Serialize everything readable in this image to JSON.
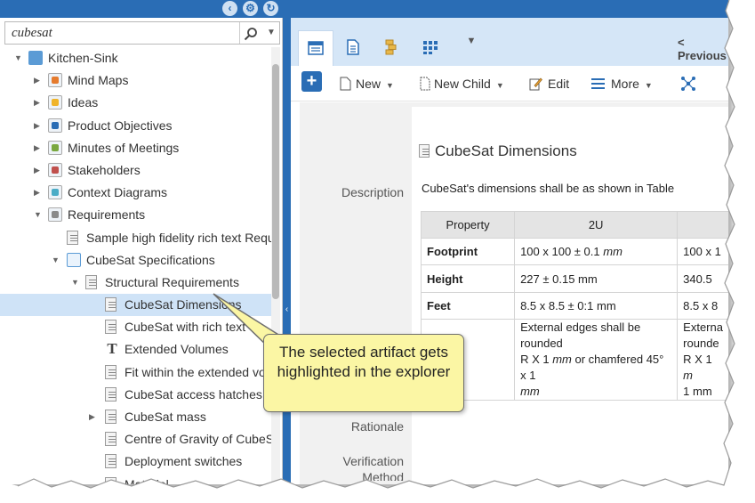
{
  "search": {
    "value": "cubesat"
  },
  "tree": {
    "items": [
      {
        "label": "Kitchen-Sink",
        "depth": 0,
        "expand": "open",
        "icon": "folder-open-icon"
      },
      {
        "label": "Mind Maps",
        "depth": 1,
        "expand": "closed",
        "icon": "mind-map-module-icon"
      },
      {
        "label": "Ideas",
        "depth": 1,
        "expand": "closed",
        "icon": "ideas-module-icon"
      },
      {
        "label": "Product Objectives",
        "depth": 1,
        "expand": "closed",
        "icon": "objectives-module-icon"
      },
      {
        "label": "Minutes of Meetings",
        "depth": 1,
        "expand": "closed",
        "icon": "meetings-module-icon"
      },
      {
        "label": "Stakeholders",
        "depth": 1,
        "expand": "closed",
        "icon": "stakeholders-module-icon"
      },
      {
        "label": "Context Diagrams",
        "depth": 1,
        "expand": "closed",
        "icon": "context-diagram-module-icon"
      },
      {
        "label": "Requirements",
        "depth": 1,
        "expand": "open",
        "icon": "requirements-module-icon"
      },
      {
        "label": "Sample high fidelity rich text Requ",
        "depth": 2,
        "expand": "none",
        "icon": "document-icon"
      },
      {
        "label": "CubeSat Specifications",
        "depth": 2,
        "expand": "open",
        "icon": "folder-outline-icon"
      },
      {
        "label": "Structural Requirements",
        "depth": 3,
        "expand": "open",
        "icon": "document-icon"
      },
      {
        "label": "CubeSat Dimensions",
        "depth": 4,
        "expand": "none",
        "icon": "document-icon",
        "selected": true
      },
      {
        "label": "CubeSat with rich text",
        "depth": 4,
        "expand": "none",
        "icon": "document-icon"
      },
      {
        "label": "Extended Volumes",
        "depth": 4,
        "expand": "none",
        "icon": "text-T-icon"
      },
      {
        "label": "Fit within the extended vo",
        "depth": 4,
        "expand": "none",
        "icon": "document-icon"
      },
      {
        "label": "CubeSat access hatches",
        "depth": 4,
        "expand": "none",
        "icon": "document-icon"
      },
      {
        "label": "CubeSat mass",
        "depth": 4,
        "expand": "closed",
        "icon": "document-icon"
      },
      {
        "label": "Centre of Gravity of CubeS",
        "depth": 4,
        "expand": "none",
        "icon": "document-icon"
      },
      {
        "label": "Deployment switches",
        "depth": 4,
        "expand": "none",
        "icon": "document-icon"
      },
      {
        "label": "Material",
        "depth": 4,
        "expand": "none",
        "icon": "document-icon"
      }
    ]
  },
  "tabs": {
    "previous_label": "< Previous"
  },
  "toolbar": {
    "new_label": "New",
    "new_child_label": "New Child",
    "edit_label": "Edit",
    "more_label": "More"
  },
  "artifact": {
    "title": "CubeSat Dimensions",
    "labels": {
      "description": "Description",
      "rationale": "Rationale",
      "verification": "Verification",
      "method_fragment": "Method"
    },
    "description": "CubeSat's dimensions shall be as shown in Table",
    "table": {
      "headers": [
        "Property",
        "2U"
      ],
      "rows": [
        {
          "property": "Footprint",
          "value_prefix": "100 x 100 ± 0.1 ",
          "value_unit": "mm",
          "next_fragment": "100 x 1"
        },
        {
          "property": "Height",
          "value": "227 ± 0.15 mm",
          "next_fragment": "340.5"
        },
        {
          "property": "Feet",
          "value": "8.5 x 8.5 ± 0:1 mm",
          "next_fragment": "8.5 x 8"
        },
        {
          "property": "",
          "value_line1": "External edges shall be rounded",
          "value_line2_prefix": "R X 1 ",
          "value_line2_unit": "mm",
          "value_line2_suffix": " or chamfered 45° x 1",
          "value_line3_unit": "mm",
          "next_line1": "Externa",
          "next_line2": "rounde",
          "next_line3_prefix": "R X 1 ",
          "next_line3_unit": "m",
          "next_line4": "1 mm"
        }
      ]
    }
  },
  "callout": {
    "text": "The selected artifact gets highlighted in the explorer"
  },
  "colors": {
    "accent": "#2a6db5",
    "tab_strip": "#d5e6f7",
    "selection": "#cfe3f7",
    "callout": "#fbf6a4"
  }
}
